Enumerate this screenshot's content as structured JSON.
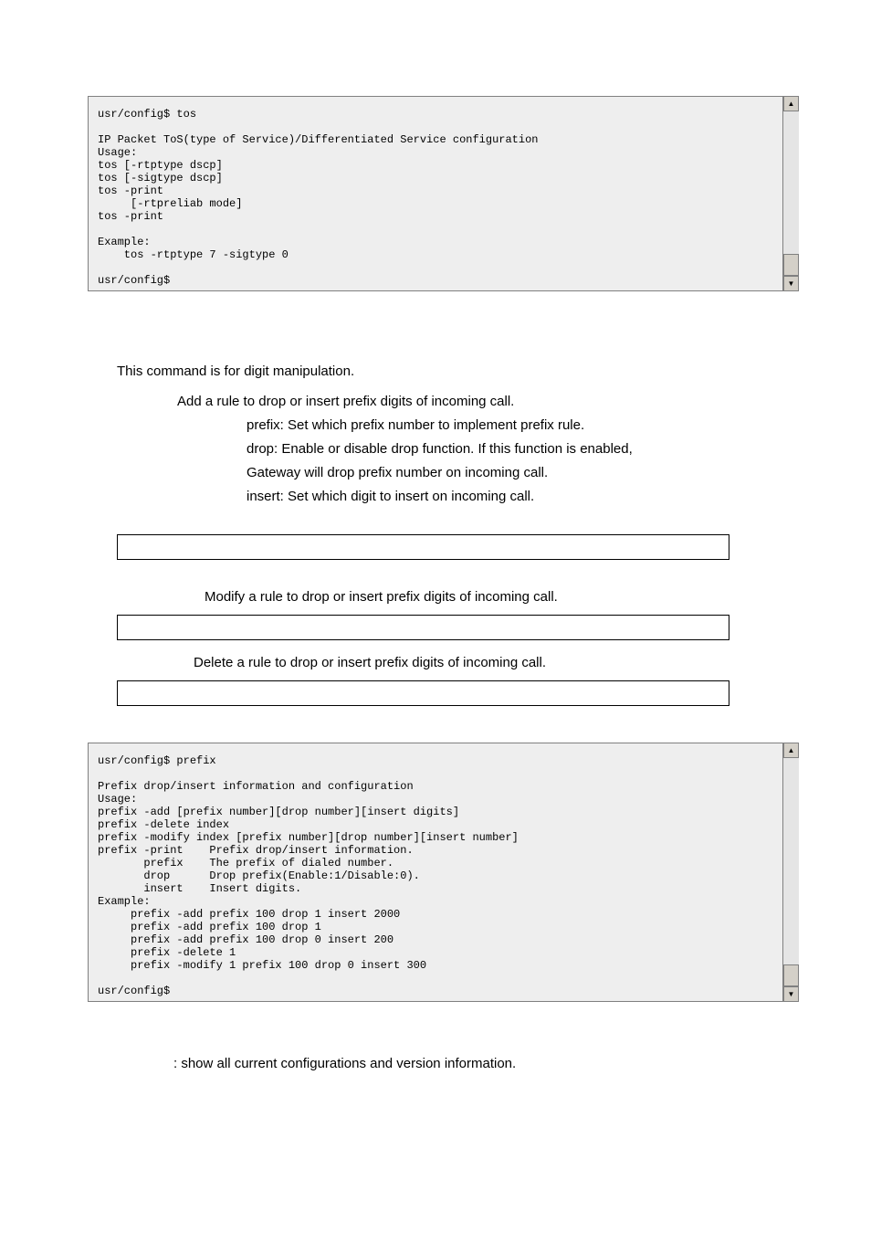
{
  "code1": "usr/config$ tos\n\nIP Packet ToS(type of Service)/Differentiated Service configuration\nUsage:\ntos [-rtptype dscp]\ntos [-sigtype dscp]\ntos -print\n     [-rtpreliab mode]\ntos -print\n\nExample:\n    tos -rtptype 7 -sigtype 0\n\nusr/config$",
  "body": {
    "intro": "This command is for digit manipulation.",
    "add_line": "Add a rule to drop or insert prefix digits of incoming call.",
    "prefix_line": "prefix: Set which prefix number to implement prefix rule.",
    "drop_line": "drop: Enable or disable drop function. If this function is enabled,",
    "drop_line2": "Gateway will drop prefix number on incoming call.",
    "insert_line": "insert: Set which digit to insert on incoming call.",
    "modify_line": "Modify a rule to drop or insert prefix digits of incoming call.",
    "delete_line": "Delete a rule to drop or insert prefix digits of incoming call.",
    "show_line": ": show all current configurations and version information."
  },
  "code2": "usr/config$ prefix\n\nPrefix drop/insert information and configuration\nUsage:\nprefix -add [prefix number][drop number][insert digits]\nprefix -delete index\nprefix -modify index [prefix number][drop number][insert number]\nprefix -print    Prefix drop/insert information.\n       prefix    The prefix of dialed number.\n       drop      Drop prefix(Enable:1/Disable:0).\n       insert    Insert digits.\nExample:\n     prefix -add prefix 100 drop 1 insert 2000\n     prefix -add prefix 100 drop 1\n     prefix -add prefix 100 drop 0 insert 200\n     prefix -delete 1\n     prefix -modify 1 prefix 100 drop 0 insert 300\n\nusr/config$",
  "scroll": {
    "up": "▲",
    "down": "▼"
  }
}
